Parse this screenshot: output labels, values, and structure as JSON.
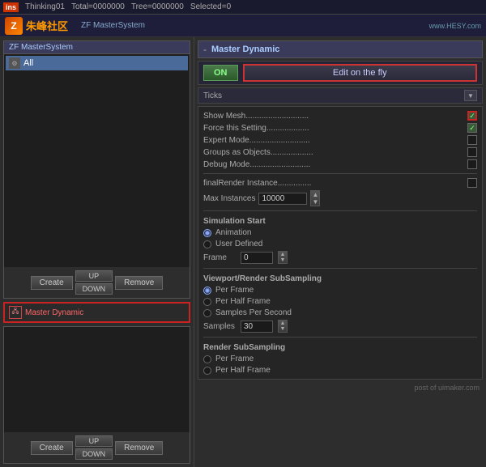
{
  "topbar": {
    "logo": "ins",
    "title": "Thinking01",
    "total_label": "Total=0000000",
    "tree_label": "Tree=0000000",
    "selected_label": "Selected=0"
  },
  "community": {
    "icon_letter": "Z",
    "name": "朱峰社区",
    "link1": "ZF  MasterSystem",
    "site": "www.HESY.com"
  },
  "left": {
    "top_header": "ZF  MasterSystem",
    "all_item": "All",
    "create_btn": "Create",
    "up_btn": "UP",
    "down_btn": "DOWN",
    "remove_btn": "Remove",
    "selected_name": "Master Dynamic",
    "create_btn2": "Create",
    "up_btn2": "UP",
    "down_btn2": "DOWN",
    "remove_btn2": "Remove"
  },
  "right": {
    "title": "Master Dynamic",
    "minus_btn": "-",
    "on_btn": "ON",
    "edit_fly_btn": "Edit on the fly",
    "ticks_label": "Ticks",
    "show_mesh_label": "Show Mesh............................",
    "force_setting_label": "Force this Setting...................",
    "expert_mode_label": "Expert Mode...........................",
    "groups_objects_label": "Groups as Objects...................",
    "debug_mode_label": "Debug Mode...........................",
    "final_render_label": "finalRender Instance...............",
    "max_instances_label": "Max Instances",
    "max_instances_value": "10000",
    "simulation_start_label": "Simulation Start",
    "animation_label": "Animation",
    "user_defined_label": "User Defined",
    "frame_label": "Frame",
    "frame_value": "0",
    "viewport_render_label": "Viewport/Render SubSampling",
    "per_frame_label": "Per Frame",
    "per_half_frame_label": "Per Half Frame",
    "samples_per_second_label": "Samples Per Second",
    "samples_label": "Samples",
    "samples_value": "30",
    "render_subsample_label": "Render SubSampling",
    "per_frame_render_label": "Per Frame",
    "per_half_frame_render_label": "Per Half Frame",
    "post_label": "post of uimaker.com"
  },
  "checkboxes": {
    "show_mesh": true,
    "force_setting": true,
    "expert_mode": false,
    "groups_objects": false,
    "debug_mode": false,
    "final_render": false
  },
  "radios": {
    "simulation": "animation",
    "viewport": "per_frame"
  }
}
